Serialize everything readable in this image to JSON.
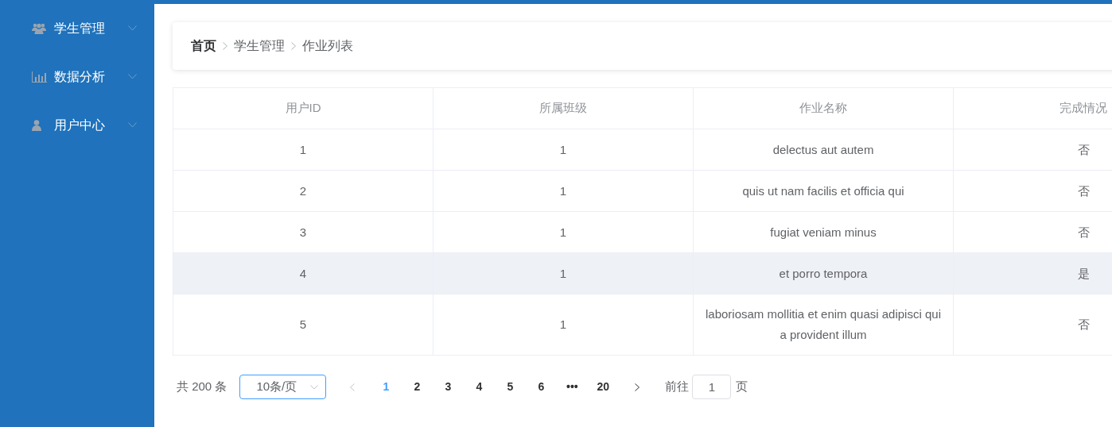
{
  "sidebar": {
    "items": [
      {
        "kind": "users",
        "label": "学生管理",
        "expanded": false
      },
      {
        "kind": "chart",
        "label": "数据分析",
        "expanded": false
      },
      {
        "kind": "user",
        "label": "用户中心",
        "expanded": false
      }
    ]
  },
  "breadcrumb": [
    "首页",
    "学生管理",
    "作业列表"
  ],
  "table": {
    "columns": [
      "用户ID",
      "所属班级",
      "作业名称",
      "完成情况"
    ],
    "rows": [
      {
        "cells": [
          "1",
          "1",
          "delectus aut autem",
          "否"
        ],
        "hovered": false
      },
      {
        "cells": [
          "2",
          "1",
          "quis ut nam facilis et officia qui",
          "否"
        ],
        "hovered": false
      },
      {
        "cells": [
          "3",
          "1",
          "fugiat veniam minus",
          "否"
        ],
        "hovered": false
      },
      {
        "cells": [
          "4",
          "1",
          "et porro tempora",
          "是"
        ],
        "hovered": true
      },
      {
        "cells": [
          "5",
          "1",
          "laboriosam mollitia et enim quasi adipisci qui a provident illum",
          "否"
        ],
        "hovered": false
      }
    ]
  },
  "pagination": {
    "total": "共 200 条",
    "page_size": "10条/页",
    "pages": [
      {
        "label": "1",
        "selected": true
      },
      {
        "label": "2",
        "selected": false
      },
      {
        "label": "3",
        "selected": false
      },
      {
        "label": "4",
        "selected": false
      },
      {
        "label": "5",
        "selected": false
      },
      {
        "label": "6",
        "selected": false
      },
      {
        "label": "•••",
        "selected": false
      },
      {
        "label": "20",
        "selected": false
      }
    ],
    "goto_label": "前往",
    "goto_value": "1",
    "goto_suffix": "页"
  }
}
